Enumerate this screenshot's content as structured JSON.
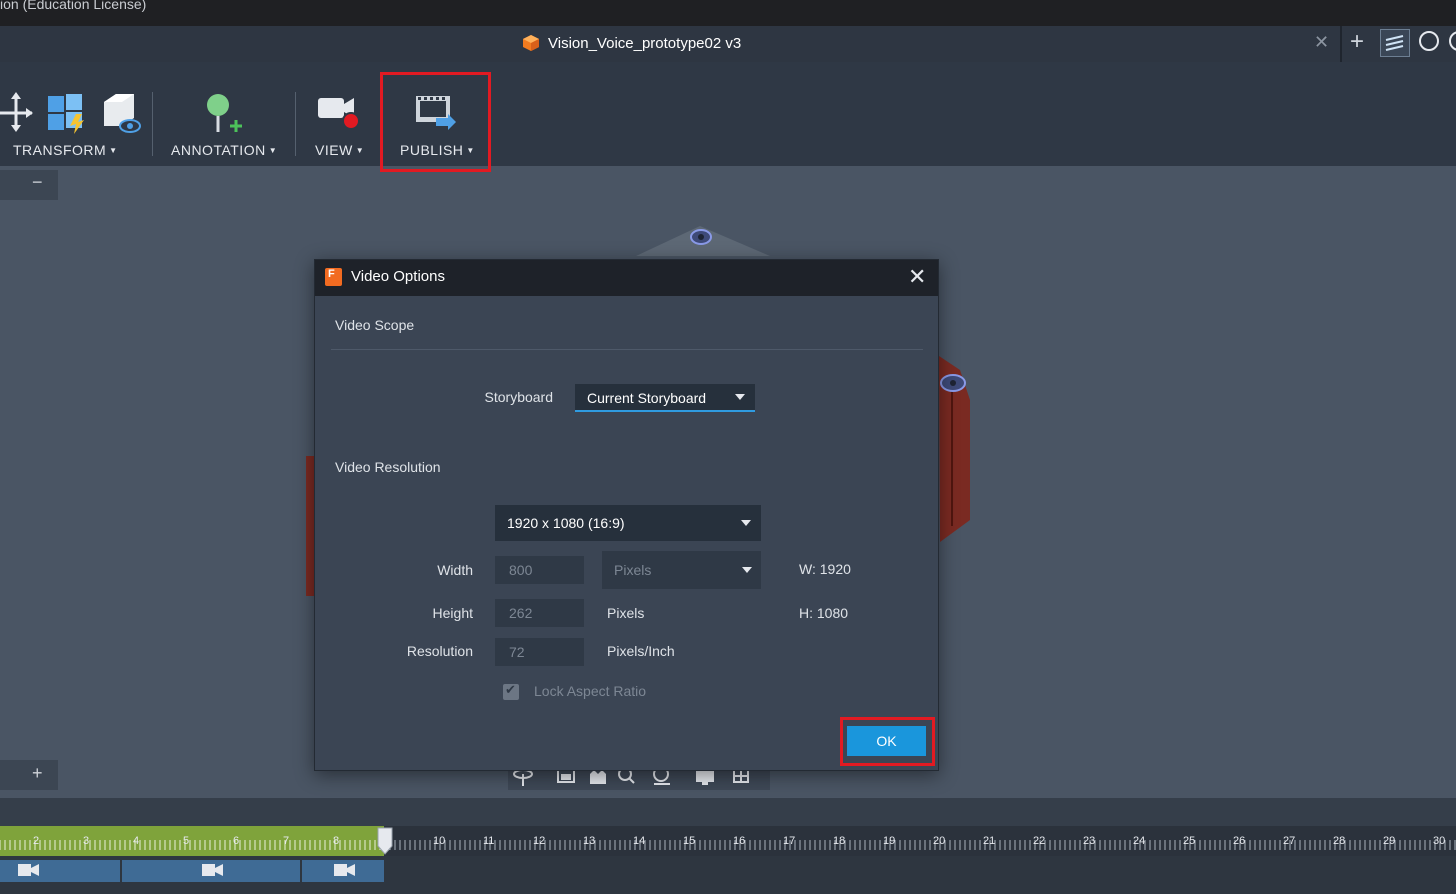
{
  "app": {
    "title_fragment": "ion (Education License)"
  },
  "document": {
    "title": "Vision_Voice_prototype02 v3"
  },
  "toolbar": {
    "groups": [
      {
        "label": "TRANSFORM"
      },
      {
        "label": "ANNOTATION"
      },
      {
        "label": "VIEW"
      },
      {
        "label": "PUBLISH"
      }
    ]
  },
  "left_panel": {
    "collapse_symbol": "−",
    "expand_symbol": "+"
  },
  "dialog": {
    "title": "Video Options",
    "close_symbol": "✕",
    "video_scope": {
      "heading": "Video Scope",
      "storyboard_label": "Storyboard",
      "storyboard_value": "Current Storyboard"
    },
    "video_resolution": {
      "heading": "Video Resolution",
      "preset_value": "1920 x 1080 (16:9)",
      "width_label": "Width",
      "width_value": "800",
      "width_unit": "Pixels",
      "width_info": "W: 1920",
      "height_label": "Height",
      "height_value": "262",
      "height_unit": "Pixels",
      "height_info": "H: 1080",
      "resolution_label": "Resolution",
      "resolution_value": "72",
      "resolution_unit": "Pixels/Inch",
      "lock_label": "Lock Aspect Ratio",
      "lock_checked": true
    },
    "ok_label": "OK"
  },
  "timeline": {
    "ticks": [
      "2",
      "3",
      "4",
      "5",
      "6",
      "7",
      "8",
      "10",
      "11",
      "12",
      "13",
      "14",
      "15",
      "16",
      "17",
      "18",
      "19",
      "20",
      "21",
      "22",
      "23",
      "24",
      "25",
      "26",
      "27",
      "28",
      "29",
      "30"
    ]
  },
  "colors": {
    "highlight": "#e21a22",
    "accent": "#1a96dc",
    "timeline_green": "#7fa33b"
  }
}
